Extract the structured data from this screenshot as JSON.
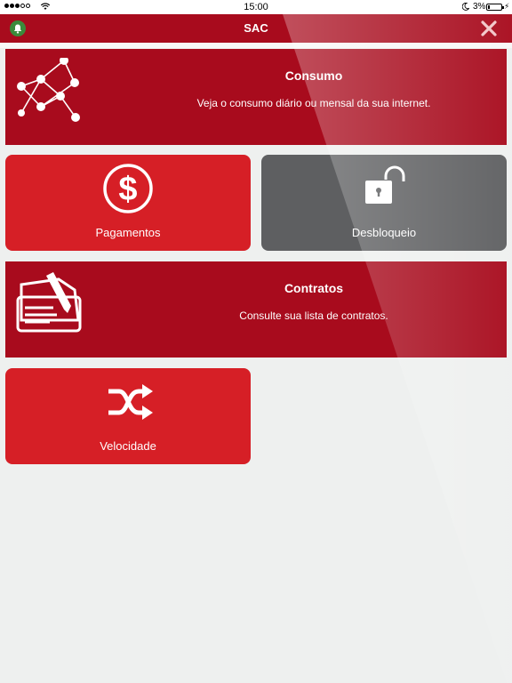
{
  "status_bar": {
    "time": "15:00",
    "battery": "3%"
  },
  "nav": {
    "title": "SAC",
    "icons": {
      "left": "bell-icon",
      "right": "close-icon"
    }
  },
  "tiles": {
    "consumo": {
      "title": "Consumo",
      "description": "Veja o consumo diário ou mensal da sua internet.",
      "icon": "graph-network-icon"
    },
    "pagamentos": {
      "label": "Pagamentos",
      "icon": "dollar-circle-icon"
    },
    "desbloqueio": {
      "label": "Desbloqueio",
      "icon": "unlock-icon"
    },
    "contratos": {
      "title": "Contratos",
      "description": "Consulte sua lista de contratos.",
      "icon": "contract-pen-icon"
    },
    "velocidade": {
      "label": "Velocidade",
      "icon": "shuffle-icon"
    }
  },
  "colors": {
    "brand_dark_red": "#a80b1d",
    "tile_red": "#d61f26",
    "tile_gray": "#5e5f61",
    "background": "#eef0ef",
    "bell_green": "#3b8a3b"
  }
}
